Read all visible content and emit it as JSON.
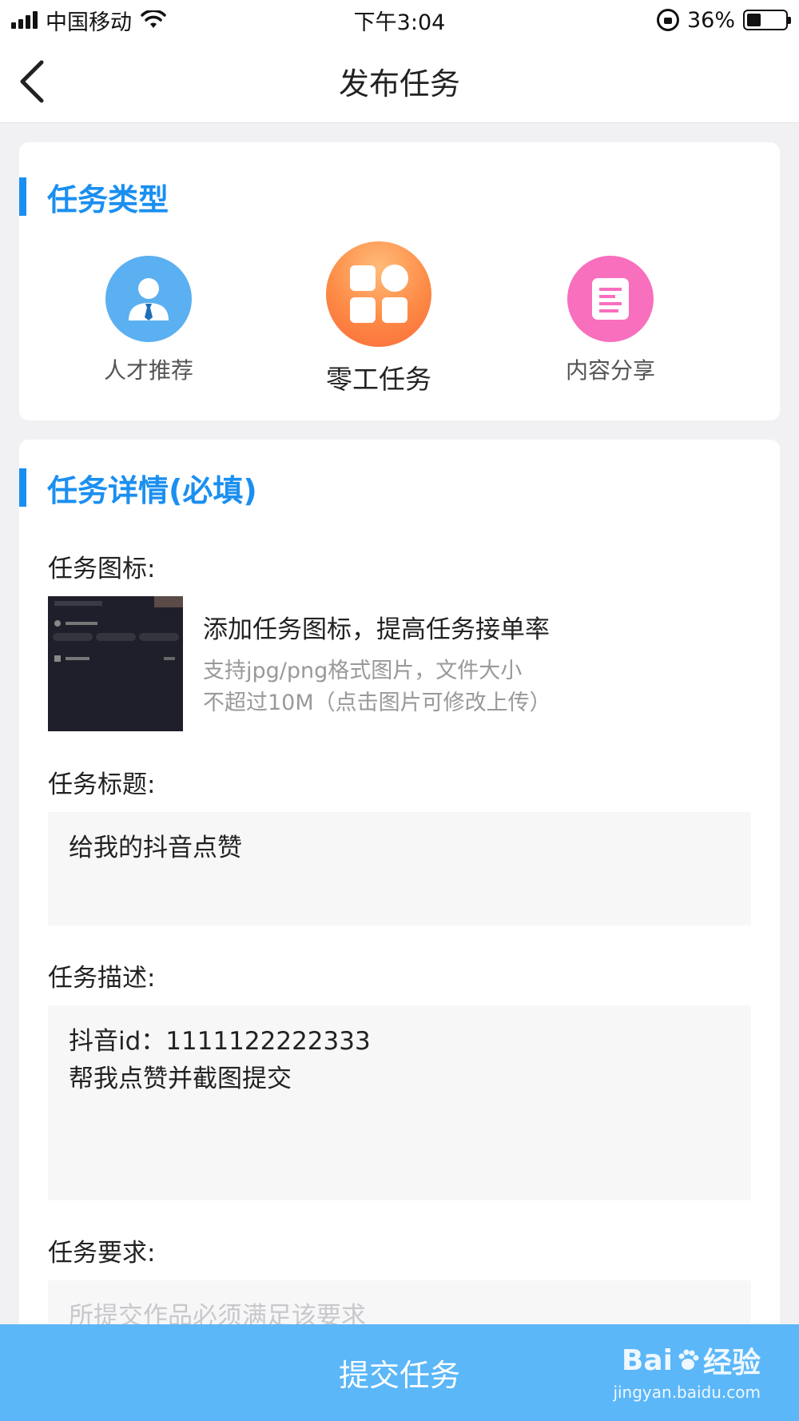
{
  "status_bar": {
    "carrier": "中国移动",
    "time": "下午3:04",
    "battery_percent": "36%",
    "battery_level": 0.36
  },
  "nav": {
    "title": "发布任务",
    "back_icon": "chevron-left-icon"
  },
  "task_type": {
    "heading": "任务类型",
    "options": [
      {
        "label": "人才推荐",
        "icon": "person-icon",
        "color": "#5ab0f0"
      },
      {
        "label": "零工任务",
        "icon": "grid-icon",
        "color": "#fd8a45",
        "selected": true
      },
      {
        "label": "内容分享",
        "icon": "document-icon",
        "color": "#f86fbe"
      }
    ]
  },
  "task_detail": {
    "heading": "任务详情(必填)",
    "icon_field": {
      "label": "任务图标:",
      "upload_title": "添加任务图标，提高任务接单率",
      "hint_line1": "支持jpg/png格式图片，文件大小",
      "hint_line2": "不超过10M（点击图片可修改上传）"
    },
    "title_field": {
      "label": "任务标题:",
      "value": "给我的抖音点赞"
    },
    "desc_field": {
      "label": "任务描述:",
      "line1": "抖音id：1111122222333",
      "line2": "帮我点赞并截图提交"
    },
    "req_field": {
      "label": "任务要求:",
      "placeholder": "所提交作品必须满足该要求"
    }
  },
  "submit": {
    "label": "提交任务",
    "color": "#5bb7f8"
  },
  "watermark": {
    "logo_text": "Bai",
    "logo_text2": "经验",
    "url": "jingyan.baidu.com"
  },
  "accent_color": "#1b8ff0"
}
